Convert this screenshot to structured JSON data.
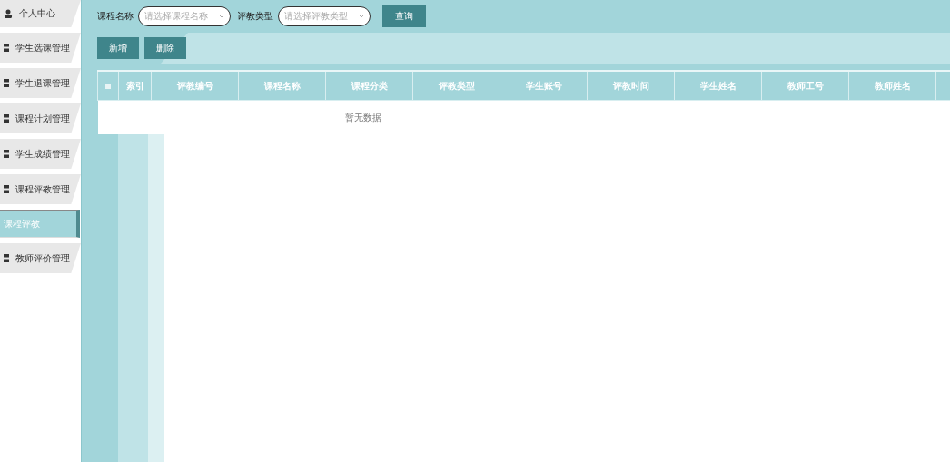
{
  "sidebar": {
    "items": [
      {
        "label": "个人中心",
        "kind": "person",
        "selected": false
      },
      {
        "label": "学生选课管理",
        "kind": "menu",
        "selected": false
      },
      {
        "label": "学生退课管理",
        "kind": "menu",
        "selected": false
      },
      {
        "label": "课程计划管理",
        "kind": "menu",
        "selected": false
      },
      {
        "label": "学生成绩管理",
        "kind": "menu",
        "selected": false
      },
      {
        "label": "课程评教管理",
        "kind": "menu",
        "selected": false
      },
      {
        "label": "课程评教",
        "kind": "submenu",
        "selected": true
      },
      {
        "label": "教师评价管理",
        "kind": "menu",
        "selected": false
      }
    ]
  },
  "search": {
    "fields": [
      {
        "label": "课程名称",
        "placeholder": "请选择课程名称"
      },
      {
        "label": "评教类型",
        "placeholder": "请选择评教类型"
      }
    ],
    "button": "查询"
  },
  "actions": [
    "新增",
    "删除"
  ],
  "table": {
    "select_all_checked": false,
    "columns": [
      "索引",
      "评教编号",
      "课程名称",
      "课程分类",
      "评教类型",
      "学生账号",
      "评教时间",
      "学生姓名",
      "教师工号",
      "教师姓名"
    ],
    "empty_text": "暂无数据"
  }
}
